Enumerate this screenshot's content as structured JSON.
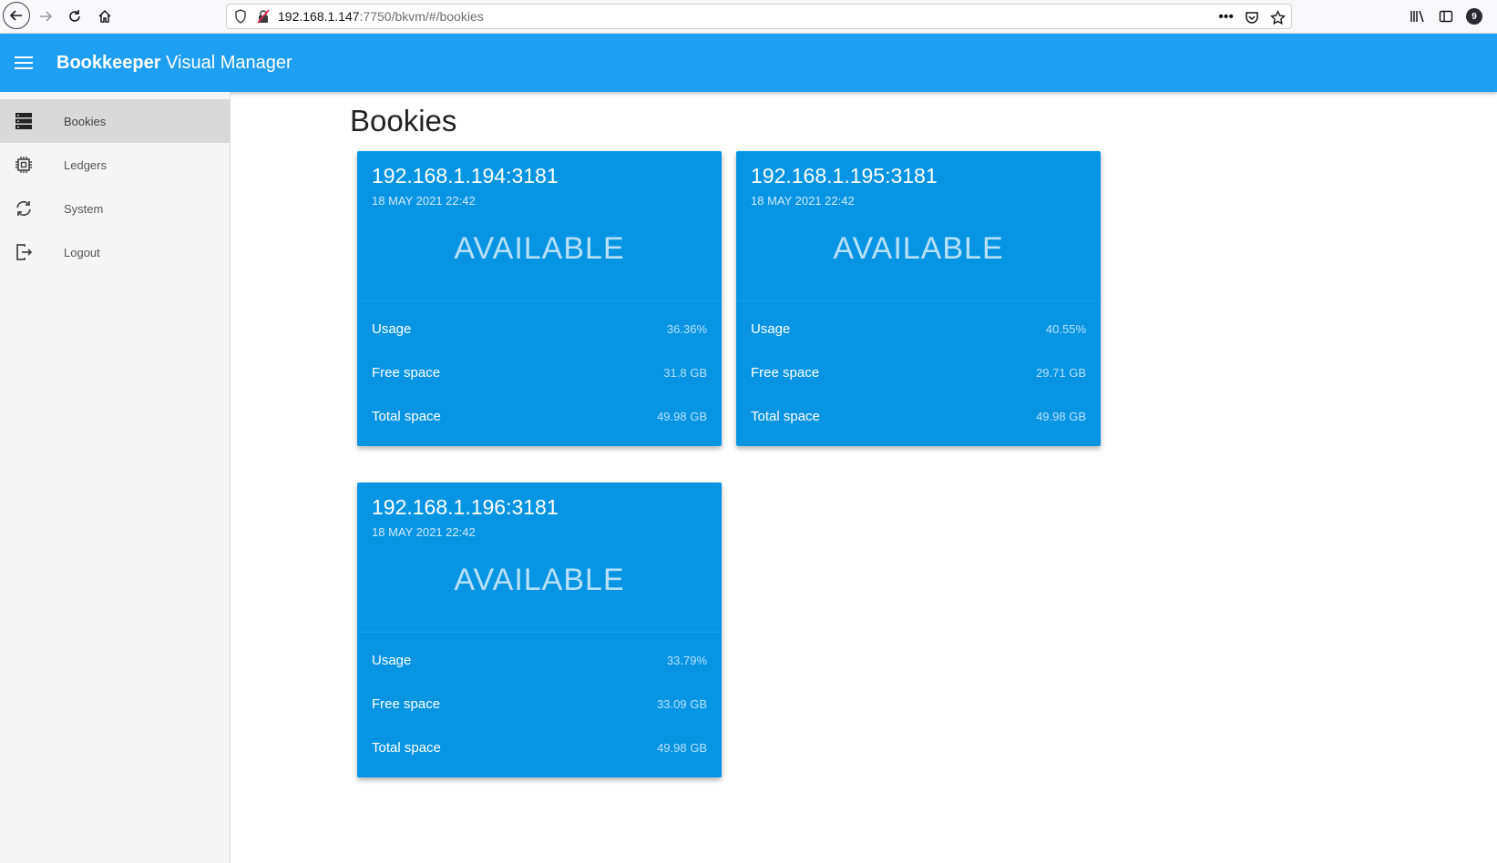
{
  "browser": {
    "url_host": "192.168.1.147",
    "url_rest": ":7750/bkvm/#/bookies",
    "badge_count": "9"
  },
  "app_bar": {
    "title_bold": "Bookkeeper",
    "title_rest": " Visual Manager",
    "color": "#1e9ff2"
  },
  "sidebar": {
    "items": [
      {
        "label": "Bookies",
        "icon": "server-icon",
        "active": true
      },
      {
        "label": "Ledgers",
        "icon": "chip-icon",
        "active": false
      },
      {
        "label": "System",
        "icon": "sync-icon",
        "active": false
      },
      {
        "label": "Logout",
        "icon": "logout-icon",
        "active": false
      }
    ]
  },
  "main": {
    "title": "Bookies",
    "card_color": "#0795e3",
    "cards": [
      {
        "address": "192.168.1.194:3181",
        "date": "18 MAY 2021 22:42",
        "status": "AVAILABLE",
        "usage_label": "Usage",
        "usage": "36.36%",
        "free_label": "Free space",
        "free": "31.8 GB",
        "total_label": "Total space",
        "total": "49.98 GB"
      },
      {
        "address": "192.168.1.195:3181",
        "date": "18 MAY 2021 22:42",
        "status": "AVAILABLE",
        "usage_label": "Usage",
        "usage": "40.55%",
        "free_label": "Free space",
        "free": "29.71 GB",
        "total_label": "Total space",
        "total": "49.98 GB"
      },
      {
        "address": "192.168.1.196:3181",
        "date": "18 MAY 2021 22:42",
        "status": "AVAILABLE",
        "usage_label": "Usage",
        "usage": "33.79%",
        "free_label": "Free space",
        "free": "33.09 GB",
        "total_label": "Total space",
        "total": "49.98 GB"
      }
    ]
  }
}
